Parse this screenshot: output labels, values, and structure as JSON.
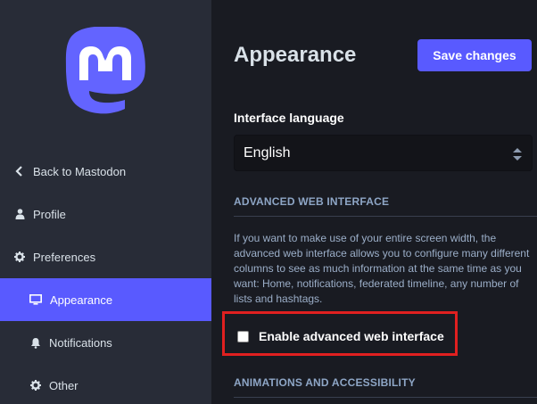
{
  "sidebar": {
    "logo_icon": "mastodon-logo-icon",
    "items": [
      {
        "label": "Back to Mastodon",
        "icon": "chevron-left-icon"
      },
      {
        "label": "Profile",
        "icon": "user-icon"
      },
      {
        "label": "Preferences",
        "icon": "gear-icon"
      },
      {
        "label": "Appearance",
        "icon": "desktop-icon",
        "active": true
      },
      {
        "label": "Notifications",
        "icon": "bell-icon"
      },
      {
        "label": "Other",
        "icon": "gear-icon"
      }
    ]
  },
  "main": {
    "title": "Appearance",
    "save_label": "Save changes",
    "language": {
      "label": "Interface language",
      "selected": "English"
    },
    "advanced": {
      "section_title": "ADVANCED WEB INTERFACE",
      "hint": "If you want to make use of your entire screen width, the advanced web interface allows you to configure many different columns to see as much information at the same time as you want: Home, notifications, federated timeline, any number of lists and hashtags.",
      "checkbox_label": "Enable advanced web interface",
      "checked": false
    },
    "animations": {
      "section_title": "ANIMATIONS AND ACCESSIBILITY"
    }
  },
  "colors": {
    "accent": "#595aff",
    "sidebar_bg": "#282c37",
    "main_bg": "#191b22",
    "highlight": "#e02020"
  }
}
